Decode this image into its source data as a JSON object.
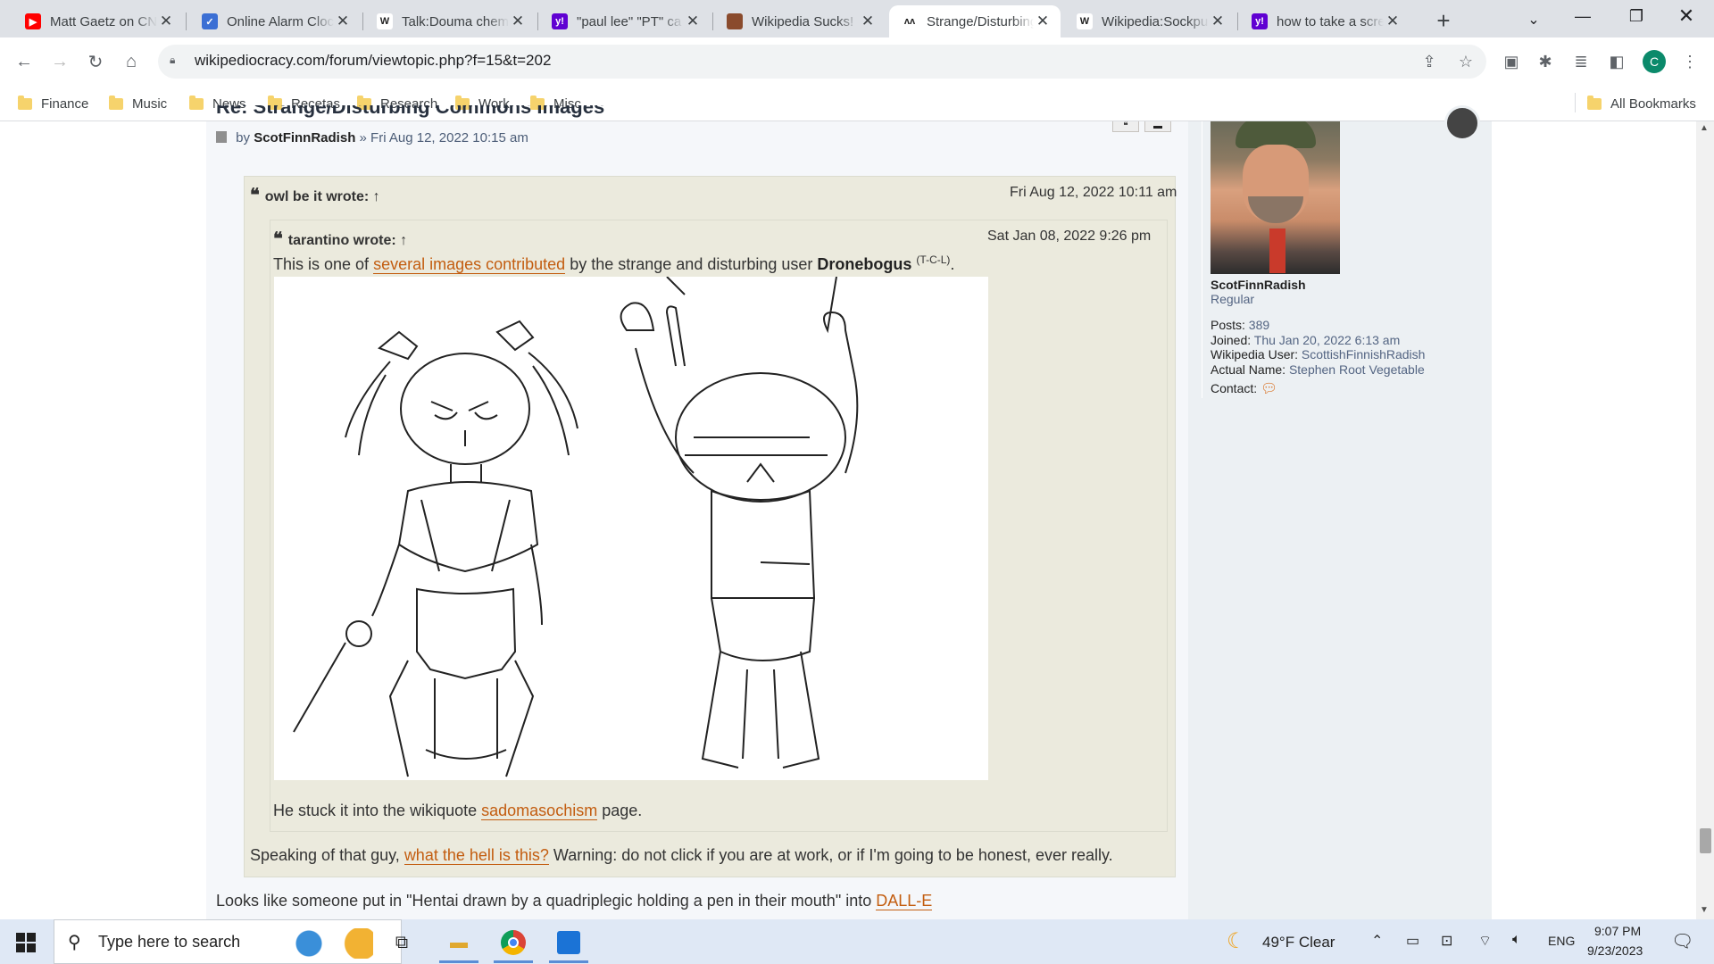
{
  "browser": {
    "tabs": [
      {
        "title": "Matt Gaetz on CNN",
        "icon": "youtube-icon",
        "color": "#ff0000",
        "glyph": "▶"
      },
      {
        "title": "Online Alarm Clock",
        "icon": "check-circle-icon",
        "color": "#3b6fd4",
        "glyph": "✓"
      },
      {
        "title": "Talk:Douma chemical",
        "icon": "wikipedia-icon",
        "color": "#ffffff",
        "glyph": "W"
      },
      {
        "title": "\"paul lee\" \"PT\" ca",
        "icon": "yahoo-icon",
        "color": "#6001d2",
        "glyph": "y!"
      },
      {
        "title": "Wikipedia Sucks!",
        "icon": "site-favicon-icon",
        "color": "#8a4b2d",
        "glyph": ""
      },
      {
        "title": "Strange/Disturbing",
        "icon": "wikipediocracy-icon",
        "color": "#ffffff",
        "glyph": "ʌʌ"
      },
      {
        "title": "Wikipedia:Sockpuppet",
        "icon": "wikipedia-icon",
        "color": "#ffffff",
        "glyph": "W"
      },
      {
        "title": "how to take a screenshot",
        "icon": "yahoo-icon",
        "color": "#6001d2",
        "glyph": "y!"
      }
    ],
    "new_tab": "+",
    "url": "wikipediocracy.com/forum/viewtopic.php?f=15&t=202",
    "profile_initial": "C",
    "bookmarks": [
      "Finance",
      "Music",
      "News",
      "Recetas",
      "Research",
      "Work",
      "Misc"
    ],
    "all_bookmarks": "All Bookmarks"
  },
  "post": {
    "title_partial": "Re: Strange/Disturbing Commons Images",
    "by_prefix": "by",
    "author": "ScotFinnRadish",
    "separator": "»",
    "date": "Fri Aug 12, 2022 10:15 am",
    "outer_quote": {
      "author": "owl be it",
      "wrote": "wrote:",
      "arrow": "↑",
      "time": "Fri Aug 12, 2022 10:11 am",
      "inner_quote": {
        "author": "tarantino",
        "wrote": "wrote:",
        "arrow": "↑",
        "time": "Sat Jan 08, 2022 9:26 pm",
        "text_1": "This is one of",
        "link_1": "several images contributed",
        "text_2": "by the strange and disturbing user",
        "user": "Dronebogus",
        "user_tcl": "(T-C-L)",
        "text_3": ".",
        "after_1": "He stuck it into the wikiquote",
        "after_link": "sadomasochism",
        "after_2": "page."
      },
      "text_1": "Speaking of that guy,",
      "link": "what the hell is this?",
      "text_2": "Warning: do not click if you are at work, or if I'm going to be honest, ever really."
    },
    "reply_text": "Looks like someone put in \"Hentai drawn by a quadriplegic holding a pen in their mouth\" into",
    "reply_link": "DALL-E"
  },
  "profile": {
    "username": "ScotFinnRadish",
    "rank": "Regular",
    "posts_label": "Posts:",
    "posts": "389",
    "joined_label": "Joined:",
    "joined": "Thu Jan 20, 2022 6:13 am",
    "wp_user_label": "Wikipedia User:",
    "wp_user": "ScottishFinnishRadish",
    "actual_name_label": "Actual Name:",
    "actual_name": "Stephen Root Vegetable",
    "contact_label": "Contact:"
  },
  "taskbar": {
    "search_placeholder": "Type here to search",
    "weather": "49°F  Clear",
    "language": "ENG",
    "time": "9:07 PM",
    "date": "9/23/2023"
  }
}
